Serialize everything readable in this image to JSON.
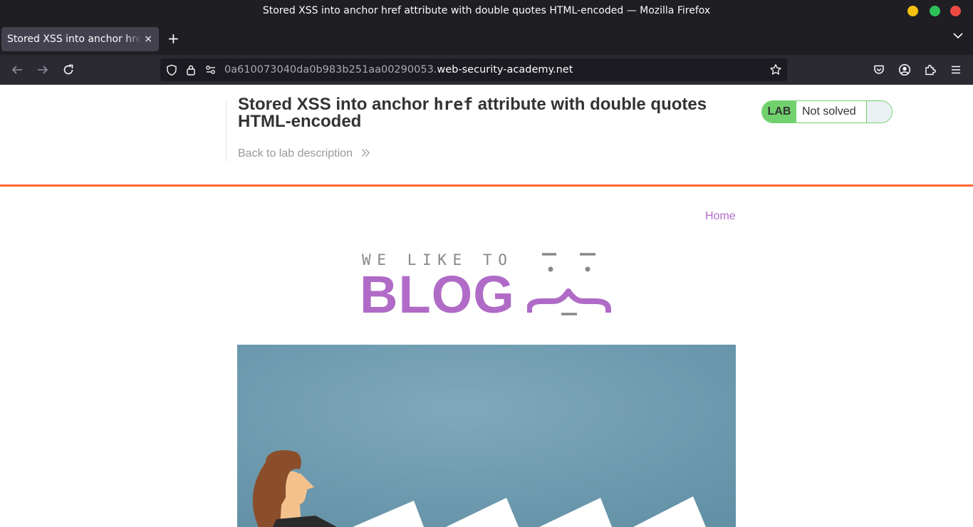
{
  "window": {
    "title": "Stored XSS into anchor href attribute with double quotes HTML-encoded — Mozilla Firefox"
  },
  "tabs": [
    {
      "label": "Stored XSS into anchor href attribute with double quotes HTML-encoded",
      "close_icon": "×"
    }
  ],
  "new_tab_icon": "+",
  "urlbar": {
    "url_subdomain": "0a610073040da0b983b251aa00290053.",
    "url_domain": "web-security-academy.net"
  },
  "lab": {
    "title_before": "Stored XSS into anchor ",
    "title_code": "href",
    "title_after": " attribute with double quotes HTML-encoded",
    "back_link": "Back to lab description",
    "badge": "LAB",
    "status": "Not solved"
  },
  "blog": {
    "nav_home": "Home",
    "logo_top": "WE LIKE TO",
    "logo_main": "BLOG"
  },
  "colors": {
    "accent_orange": "#ff6633",
    "lab_green": "#70d16d",
    "brand_purple": "#b06bc7",
    "hero_blue": "#6f9db1"
  }
}
